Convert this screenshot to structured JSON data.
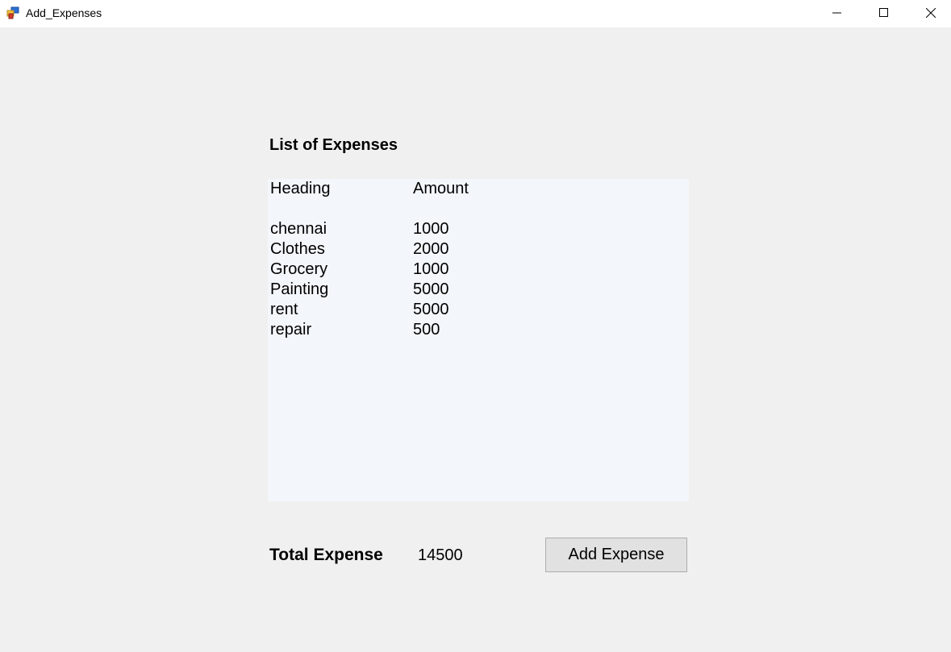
{
  "window": {
    "title": "Add_Expenses",
    "icon": "winforms-app-icon",
    "controls": [
      "minimize",
      "maximize",
      "close"
    ]
  },
  "expenses": {
    "title": "List of Expenses",
    "columns": {
      "heading": "Heading",
      "amount": "Amount"
    },
    "rows": [
      {
        "heading": "chennai",
        "amount": "1000"
      },
      {
        "heading": "Clothes",
        "amount": "2000"
      },
      {
        "heading": "Grocery",
        "amount": "1000"
      },
      {
        "heading": "Painting",
        "amount": "5000"
      },
      {
        "heading": "rent",
        "amount": "5000"
      },
      {
        "heading": "repair",
        "amount": "500"
      }
    ]
  },
  "total": {
    "label": "Total Expense",
    "value": "14500"
  },
  "actions": {
    "add_label": "Add Expense"
  },
  "colors": {
    "background": "#f0f0f0",
    "listbox": "#f3f6fa",
    "button": "#e1e1e1"
  }
}
